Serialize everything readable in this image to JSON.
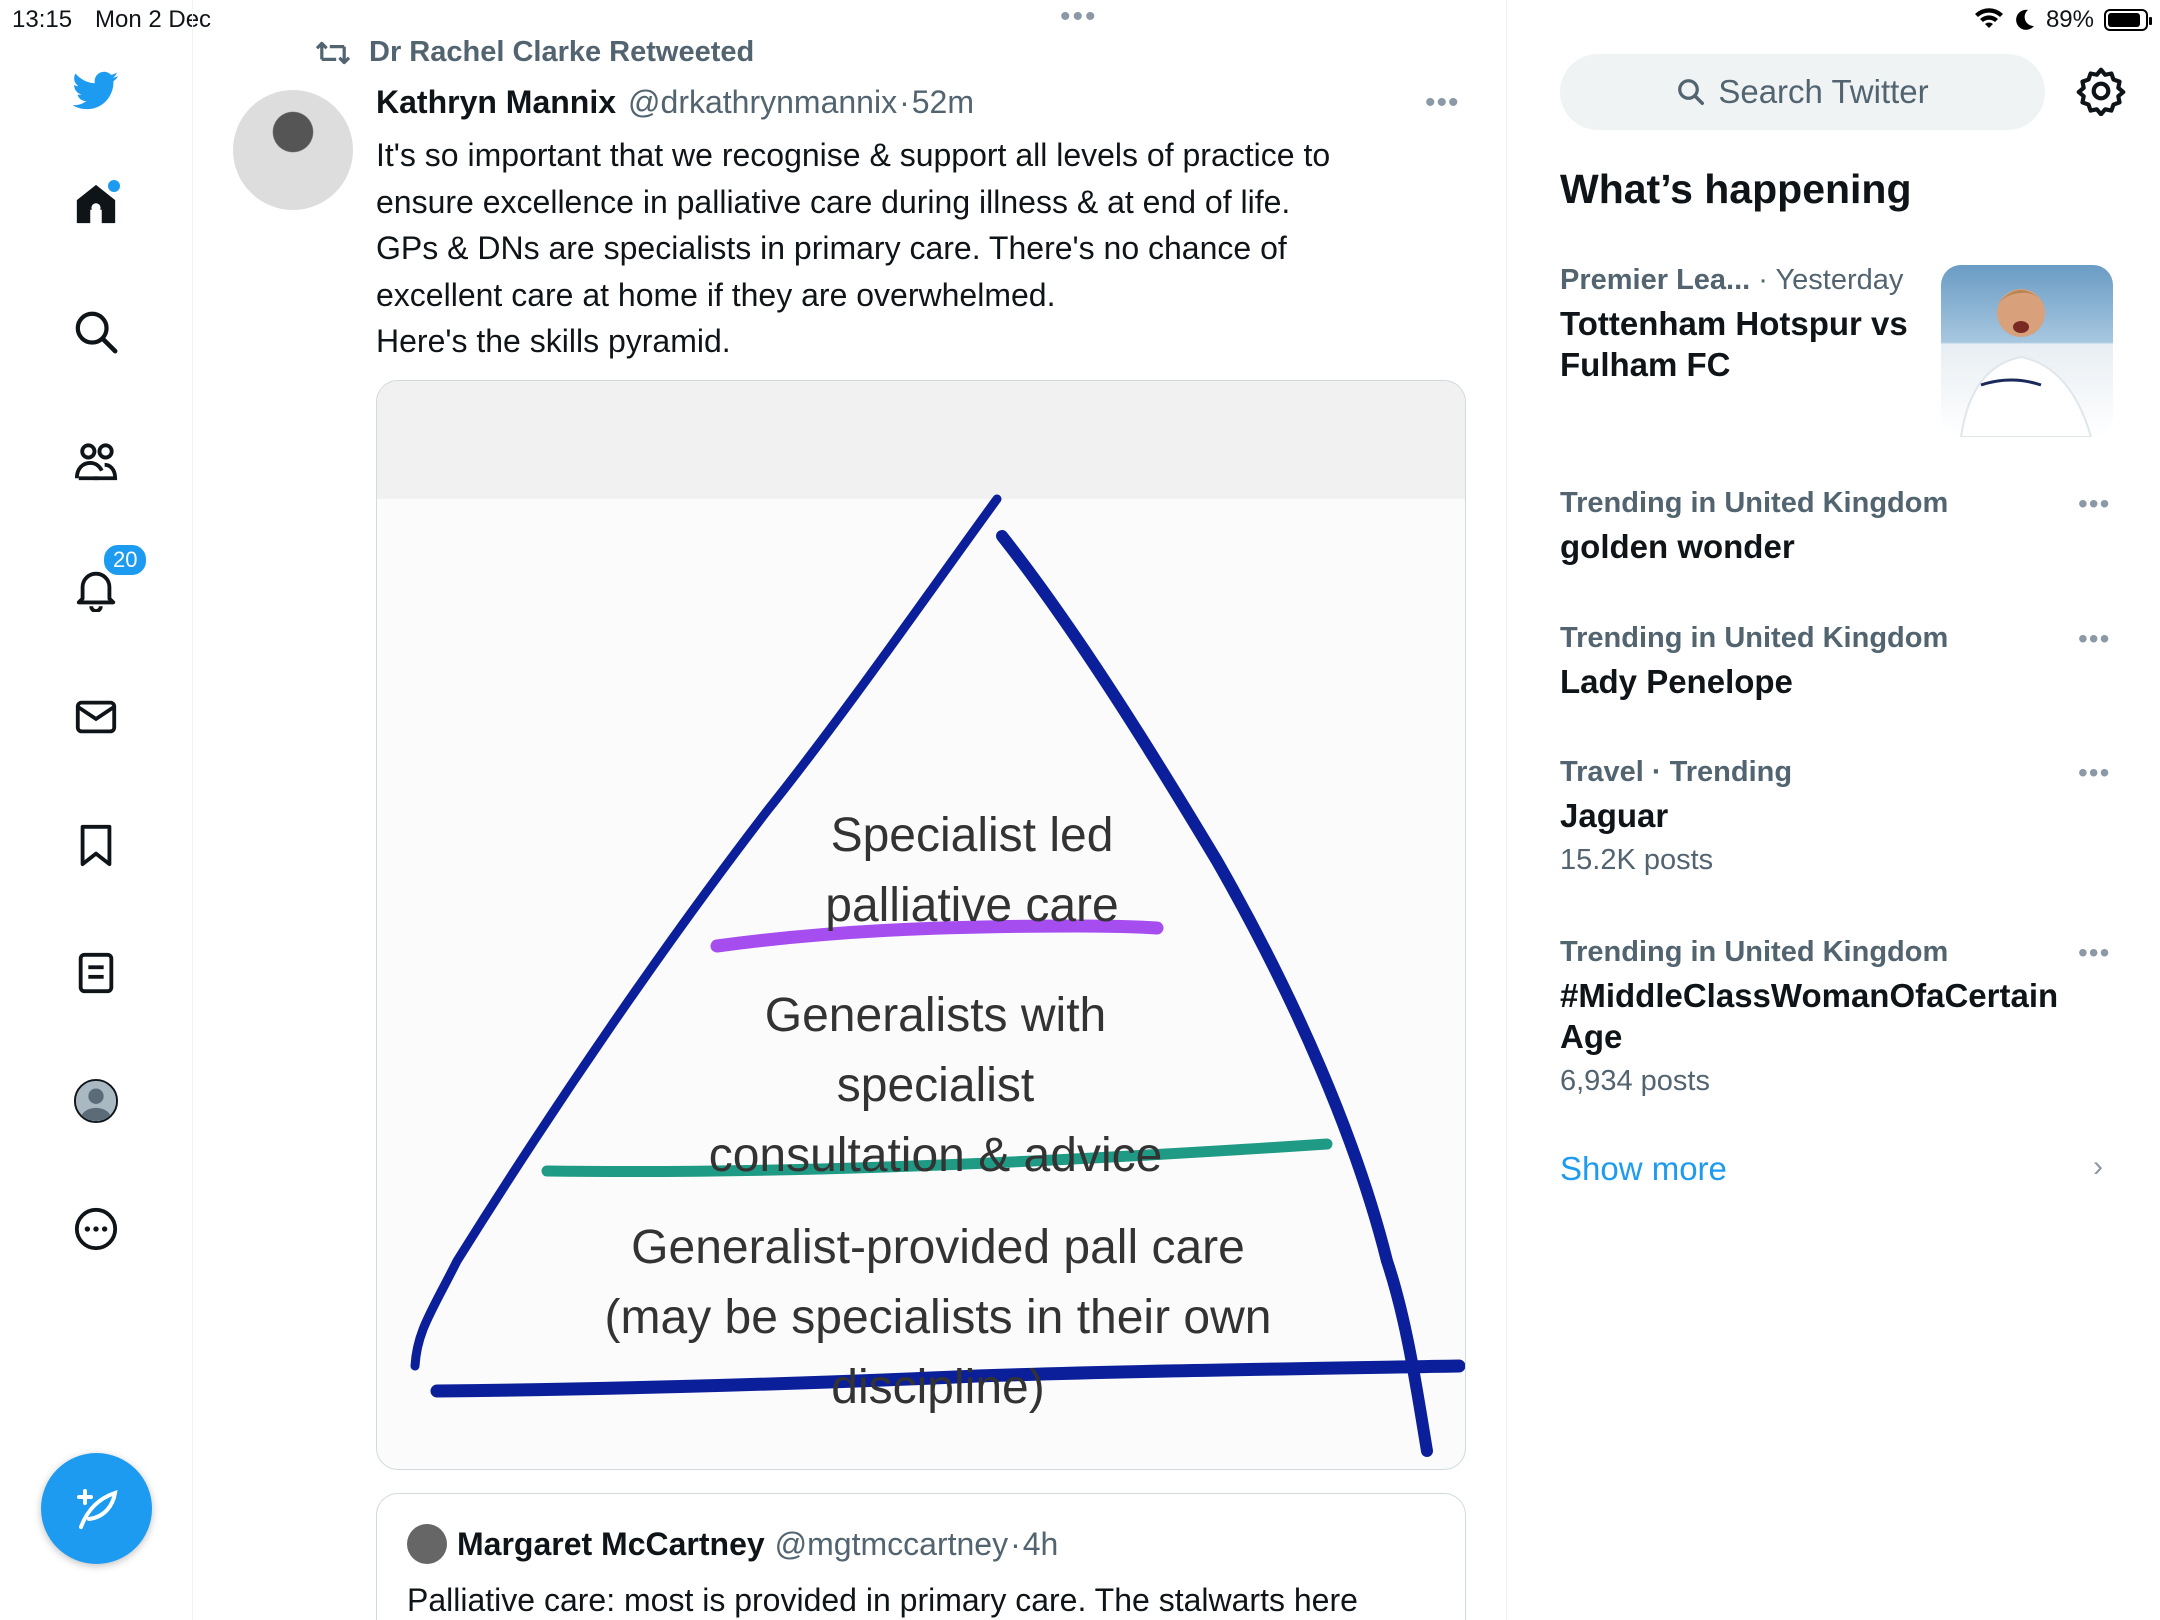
{
  "status_bar": {
    "time": "13:15",
    "date": "Mon 2 Dec",
    "center_dots": "•••",
    "battery": "89%",
    "battery_level": 0.89
  },
  "nav": {
    "notifications_badge": "20",
    "accent_color": "#1d9bf0"
  },
  "tweet": {
    "retweeted_by": "Dr Rachel Clarke Retweeted",
    "author_name": "Kathryn Mannix",
    "author_handle": "@drkathrynmannix",
    "separator": "·",
    "time": "52m",
    "more": "•••",
    "text_lines": [
      "It's so important that we recognise & support all levels of practice to",
      "ensure excellence in palliative care during illness & at end of life.",
      "GPs & DNs are specialists in primary care. There's no chance of",
      "excellent care at home if they are overwhelmed.",
      "Here's the skills pyramid."
    ],
    "image": {
      "tier_top": [
        "Specialist led",
        "palliative care"
      ],
      "tier_middle": [
        "Generalists with",
        "specialist",
        "consultation & advice"
      ],
      "tier_bottom": [
        "Generalist-provided pall care",
        "(may be specialists in their own",
        "discipline)"
      ],
      "colors": {
        "pyramid": "#0b1f9a",
        "top_line": "#a64df0",
        "middle_line": "#1f9a84"
      }
    }
  },
  "quote": {
    "author_name": "Margaret McCartney",
    "author_handle": "@mgtmccartney",
    "separator": "·",
    "time": "4h",
    "text": "Palliative care: most is provided in primary care. The stalwarts here"
  },
  "sidebar": {
    "search_placeholder": "Search Twitter",
    "section_title": "What’s happening",
    "trends": [
      {
        "category": "Premier Lea...",
        "time": "· Yesterday",
        "title_lines": [
          "Tottenham Hotspur vs",
          "Fulham FC"
        ]
      },
      {
        "category": "Trending in United Kingdom",
        "title_lines": [
          "golden wonder"
        ],
        "more": "•••"
      },
      {
        "category": "Trending in United Kingdom",
        "title_lines": [
          "Lady Penelope"
        ],
        "more": "•••"
      },
      {
        "category": "Travel · Trending",
        "title_lines": [
          "Jaguar"
        ],
        "count": "15.2K posts",
        "more": "•••"
      },
      {
        "category": "Trending in United Kingdom",
        "title_lines": [
          "#MiddleClassWomanOfaCertain",
          "Age"
        ],
        "count": "6,934 posts",
        "more": "•••"
      }
    ],
    "show_more": "Show more",
    "chevron": "›"
  }
}
